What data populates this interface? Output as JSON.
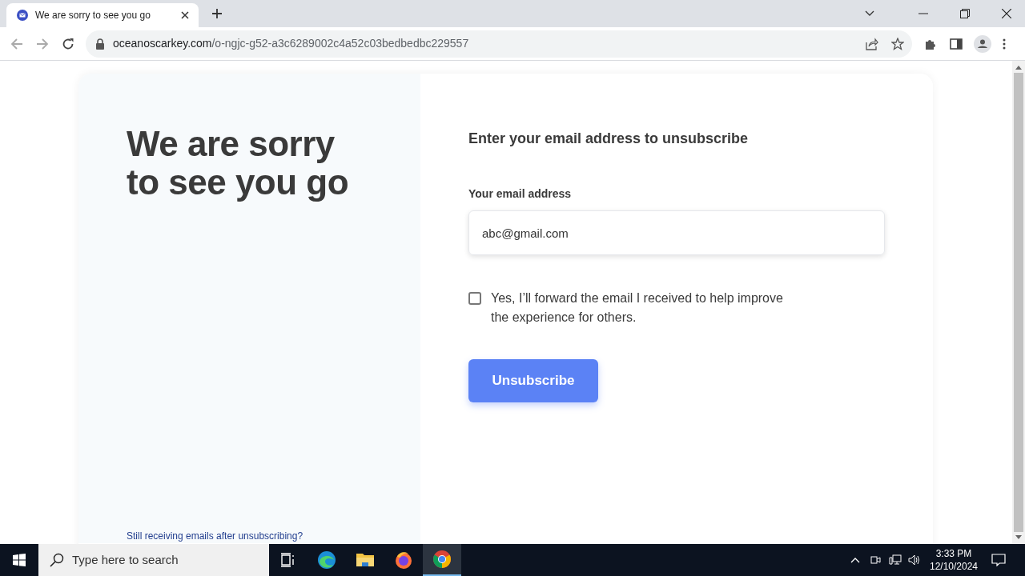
{
  "browser": {
    "tab": {
      "title": "We are sorry to see you go"
    },
    "url": {
      "domain": "oceanoscarkey.com",
      "path": "/o-ngjc-g52-a3c6289002c4a52c03bedbedbc229557"
    }
  },
  "page": {
    "heading": "We are sorry to see you go",
    "help_link": "Still receiving emails after unsubscribing?",
    "form_title": "Enter your email address to unsubscribe",
    "email_label": "Your email address",
    "email_value": "abc@gmail.com",
    "forward_checkbox": {
      "label": "Yes, I’ll forward the email I received to help improve the experience for others.",
      "checked": false
    },
    "submit_button": "Unsubscribe"
  },
  "taskbar": {
    "search": {
      "placeholder": "Type here to search"
    },
    "apps": [
      {
        "kind": "taskview",
        "selected": false
      },
      {
        "kind": "edge",
        "selected": false
      },
      {
        "kind": "explorer",
        "selected": false
      },
      {
        "kind": "firefox",
        "selected": false
      },
      {
        "kind": "chrome",
        "selected": true
      }
    ],
    "clock": {
      "time": "3:33 PM",
      "date": "12/10/2024"
    }
  }
}
